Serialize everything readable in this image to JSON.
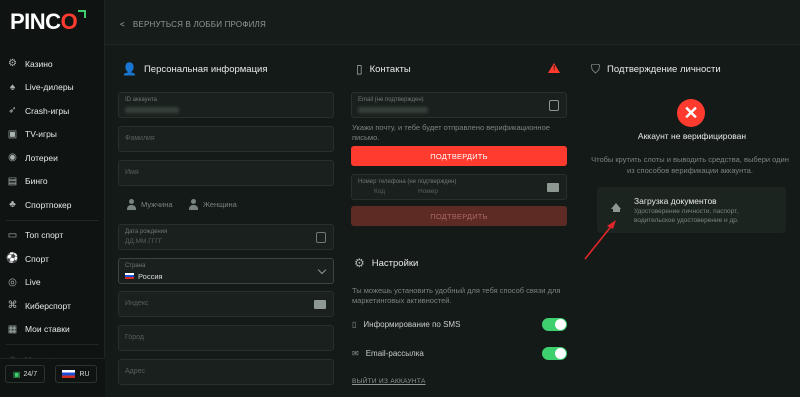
{
  "brand": {
    "logo_main": "PINC",
    "logo_accent": "O"
  },
  "sidebar": {
    "items": [
      {
        "label": "Казино",
        "icon": "gear-icon"
      },
      {
        "label": "Live-дилеры",
        "icon": "live-dealer-icon"
      },
      {
        "label": "Crash-игры",
        "icon": "rocket-icon"
      },
      {
        "label": "TV-игры",
        "icon": "tv-icon"
      },
      {
        "label": "Лотереи",
        "icon": "lottery-icon"
      },
      {
        "label": "Бинго",
        "icon": "bingo-icon"
      },
      {
        "label": "Спортпокер",
        "icon": "poker-icon"
      },
      {
        "label": "Топ спорт",
        "icon": "top-sport-icon"
      },
      {
        "label": "Спорт",
        "icon": "sport-icon"
      },
      {
        "label": "Live",
        "icon": "live-icon"
      },
      {
        "label": "Киберспорт",
        "icon": "gamepad-icon"
      },
      {
        "label": "Мои ставки",
        "icon": "bets-icon"
      },
      {
        "label": "V-sport",
        "icon": "v-sport-icon"
      }
    ],
    "support_label": "24/7",
    "language_label": "RU"
  },
  "topbar": {
    "back_label": "ВЕРНУТЬСЯ В ЛОББИ ПРОФИЛЯ"
  },
  "personal": {
    "title": "Персональная информация",
    "account_id_label": "ID аккаунта",
    "surname_placeholder": "Фамилия",
    "name_placeholder": "Имя",
    "male_label": "Мужчина",
    "female_label": "Женщина",
    "birthdate_label": "Дата рождения",
    "birthdate_placeholder": "ДД.ММ.ГГГГ",
    "country_label": "Страна",
    "country_value": "Россия",
    "index_placeholder": "Индекс",
    "city_placeholder": "Город",
    "address_placeholder": "Адрес"
  },
  "contacts": {
    "title": "Контакты",
    "email_label": "Email (не подтвержден)",
    "email_hint": "Укажи почту, и тебе будет отправлено верификационное письмо.",
    "confirm_label": "ПОДТВЕРДИТЬ",
    "phone_label": "Номер телефона (не подтвержден)",
    "phone_code_placeholder": "Код",
    "phone_number_placeholder": "Номер",
    "confirm_phone_label": "ПОДТВЕРДИТЬ"
  },
  "settings": {
    "title": "Настройки",
    "hint": "Ты можешь установить удобный для тебя способ связи для маркетинговых активностей.",
    "sms_label": "Информирование по SMS",
    "sms_enabled": true,
    "email_label": "Email-рассылка",
    "email_enabled": true,
    "logout_label": "ВЫЙТИ ИЗ АККАУНТА"
  },
  "verification": {
    "title": "Подтверждение личности",
    "status": "Аккаунт не верифицирован",
    "hint": "Чтобы крутить слоты и выводить средства, выбери один из способов верификации аккаунта.",
    "doc_title": "Загрузка документов",
    "doc_desc": "Удостоверение личности, паспорт, водительское удостоверение и др."
  },
  "colors": {
    "accent": "#ff3b2f",
    "toggle_on": "#3ecf6e",
    "background": "#141a17"
  }
}
